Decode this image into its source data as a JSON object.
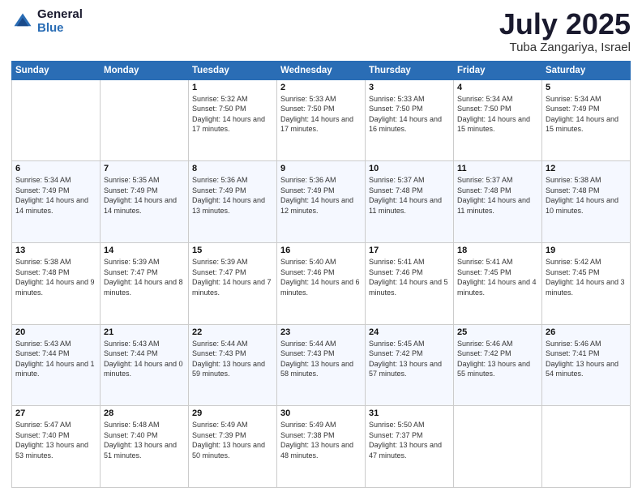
{
  "logo": {
    "general": "General",
    "blue": "Blue"
  },
  "header": {
    "month": "July 2025",
    "location": "Tuba Zangariya, Israel"
  },
  "weekdays": [
    "Sunday",
    "Monday",
    "Tuesday",
    "Wednesday",
    "Thursday",
    "Friday",
    "Saturday"
  ],
  "weeks": [
    [
      {
        "day": "",
        "info": ""
      },
      {
        "day": "",
        "info": ""
      },
      {
        "day": "1",
        "info": "Sunrise: 5:32 AM\nSunset: 7:50 PM\nDaylight: 14 hours and 17 minutes."
      },
      {
        "day": "2",
        "info": "Sunrise: 5:33 AM\nSunset: 7:50 PM\nDaylight: 14 hours and 17 minutes."
      },
      {
        "day": "3",
        "info": "Sunrise: 5:33 AM\nSunset: 7:50 PM\nDaylight: 14 hours and 16 minutes."
      },
      {
        "day": "4",
        "info": "Sunrise: 5:34 AM\nSunset: 7:50 PM\nDaylight: 14 hours and 15 minutes."
      },
      {
        "day": "5",
        "info": "Sunrise: 5:34 AM\nSunset: 7:49 PM\nDaylight: 14 hours and 15 minutes."
      }
    ],
    [
      {
        "day": "6",
        "info": "Sunrise: 5:34 AM\nSunset: 7:49 PM\nDaylight: 14 hours and 14 minutes."
      },
      {
        "day": "7",
        "info": "Sunrise: 5:35 AM\nSunset: 7:49 PM\nDaylight: 14 hours and 14 minutes."
      },
      {
        "day": "8",
        "info": "Sunrise: 5:36 AM\nSunset: 7:49 PM\nDaylight: 14 hours and 13 minutes."
      },
      {
        "day": "9",
        "info": "Sunrise: 5:36 AM\nSunset: 7:49 PM\nDaylight: 14 hours and 12 minutes."
      },
      {
        "day": "10",
        "info": "Sunrise: 5:37 AM\nSunset: 7:48 PM\nDaylight: 14 hours and 11 minutes."
      },
      {
        "day": "11",
        "info": "Sunrise: 5:37 AM\nSunset: 7:48 PM\nDaylight: 14 hours and 11 minutes."
      },
      {
        "day": "12",
        "info": "Sunrise: 5:38 AM\nSunset: 7:48 PM\nDaylight: 14 hours and 10 minutes."
      }
    ],
    [
      {
        "day": "13",
        "info": "Sunrise: 5:38 AM\nSunset: 7:48 PM\nDaylight: 14 hours and 9 minutes."
      },
      {
        "day": "14",
        "info": "Sunrise: 5:39 AM\nSunset: 7:47 PM\nDaylight: 14 hours and 8 minutes."
      },
      {
        "day": "15",
        "info": "Sunrise: 5:39 AM\nSunset: 7:47 PM\nDaylight: 14 hours and 7 minutes."
      },
      {
        "day": "16",
        "info": "Sunrise: 5:40 AM\nSunset: 7:46 PM\nDaylight: 14 hours and 6 minutes."
      },
      {
        "day": "17",
        "info": "Sunrise: 5:41 AM\nSunset: 7:46 PM\nDaylight: 14 hours and 5 minutes."
      },
      {
        "day": "18",
        "info": "Sunrise: 5:41 AM\nSunset: 7:45 PM\nDaylight: 14 hours and 4 minutes."
      },
      {
        "day": "19",
        "info": "Sunrise: 5:42 AM\nSunset: 7:45 PM\nDaylight: 14 hours and 3 minutes."
      }
    ],
    [
      {
        "day": "20",
        "info": "Sunrise: 5:43 AM\nSunset: 7:44 PM\nDaylight: 14 hours and 1 minute."
      },
      {
        "day": "21",
        "info": "Sunrise: 5:43 AM\nSunset: 7:44 PM\nDaylight: 14 hours and 0 minutes."
      },
      {
        "day": "22",
        "info": "Sunrise: 5:44 AM\nSunset: 7:43 PM\nDaylight: 13 hours and 59 minutes."
      },
      {
        "day": "23",
        "info": "Sunrise: 5:44 AM\nSunset: 7:43 PM\nDaylight: 13 hours and 58 minutes."
      },
      {
        "day": "24",
        "info": "Sunrise: 5:45 AM\nSunset: 7:42 PM\nDaylight: 13 hours and 57 minutes."
      },
      {
        "day": "25",
        "info": "Sunrise: 5:46 AM\nSunset: 7:42 PM\nDaylight: 13 hours and 55 minutes."
      },
      {
        "day": "26",
        "info": "Sunrise: 5:46 AM\nSunset: 7:41 PM\nDaylight: 13 hours and 54 minutes."
      }
    ],
    [
      {
        "day": "27",
        "info": "Sunrise: 5:47 AM\nSunset: 7:40 PM\nDaylight: 13 hours and 53 minutes."
      },
      {
        "day": "28",
        "info": "Sunrise: 5:48 AM\nSunset: 7:40 PM\nDaylight: 13 hours and 51 minutes."
      },
      {
        "day": "29",
        "info": "Sunrise: 5:49 AM\nSunset: 7:39 PM\nDaylight: 13 hours and 50 minutes."
      },
      {
        "day": "30",
        "info": "Sunrise: 5:49 AM\nSunset: 7:38 PM\nDaylight: 13 hours and 48 minutes."
      },
      {
        "day": "31",
        "info": "Sunrise: 5:50 AM\nSunset: 7:37 PM\nDaylight: 13 hours and 47 minutes."
      },
      {
        "day": "",
        "info": ""
      },
      {
        "day": "",
        "info": ""
      }
    ]
  ]
}
